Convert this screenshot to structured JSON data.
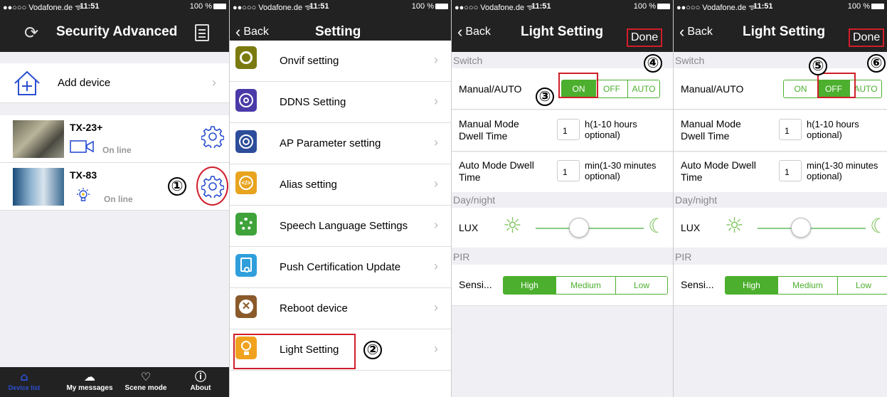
{
  "status": {
    "carrier": "●●○○○ Vodafone.de ᯤ",
    "time": "11:51",
    "battery": "100 %"
  },
  "screen1": {
    "title": "Security Advanced",
    "add_device": "Add device",
    "devices": [
      {
        "name": "TX-23+",
        "status": "On line",
        "type_icon": "camera-icon"
      },
      {
        "name": "TX-83",
        "status": "On line",
        "type_icon": "lightbulb-icon"
      }
    ],
    "tabs": [
      "Device list",
      "My messages",
      "Scene mode",
      "About"
    ],
    "marker": "①"
  },
  "screen2": {
    "back": "Back",
    "title": "Setting",
    "items": [
      {
        "label": "Onvif setting",
        "color": "#7a7a10"
      },
      {
        "label": "DDNS Setting",
        "color": "#4a3aa8"
      },
      {
        "label": "AP Parameter setting",
        "color": "#2d4d9a"
      },
      {
        "label": "Alias setting",
        "color": "#e8a41e"
      },
      {
        "label": "Speech Language Settings",
        "color": "#3fa33a"
      },
      {
        "label": "Push Certification Update",
        "color": "#2f9fdc"
      },
      {
        "label": "Reboot device",
        "color": "#8a5a2a"
      },
      {
        "label": "Light Setting",
        "color": "#f0a21e"
      }
    ],
    "marker": "②"
  },
  "light_screens": [
    {
      "back": "Back",
      "title": "Light Setting",
      "done": "Done",
      "switch_header": "Switch",
      "manual_auto": "Manual/AUTO",
      "seg": [
        "ON",
        "OFF",
        "AUTO"
      ],
      "selected": 0,
      "manual_dwell": "Manual Mode Dwell Time",
      "manual_value": "1",
      "manual_unit": "h(1-10 hours optional)",
      "auto_dwell": "Auto Mode Dwell Time",
      "auto_value": "1",
      "auto_unit": "min(1-30 minutes optional)",
      "daynight_header": "Day/night",
      "lux": "LUX",
      "lux_level": 0.4,
      "pir_header": "PIR",
      "sensi": "Sensi...",
      "sens_opts": [
        "High",
        "Medium",
        "Low"
      ],
      "sens_selected": 0,
      "markers": [
        "③",
        "④"
      ]
    },
    {
      "back": "Back",
      "title": "Light Setting",
      "done": "Done",
      "switch_header": "Switch",
      "manual_auto": "Manual/AUTO",
      "seg": [
        "ON",
        "OFF",
        "AUTO"
      ],
      "selected": 1,
      "manual_dwell": "Manual Mode Dwell Time",
      "manual_value": "1",
      "manual_unit": "h(1-10 hours optional)",
      "auto_dwell": "Auto Mode Dwell Time",
      "auto_value": "1",
      "auto_unit": "min(1-30 minutes optional)",
      "daynight_header": "Day/night",
      "lux": "LUX",
      "lux_level": 0.4,
      "pir_header": "PIR",
      "sensi": "Sensi...",
      "sens_opts": [
        "High",
        "Medium",
        "Low"
      ],
      "sens_selected": 0,
      "markers": [
        "⑤",
        "⑥"
      ]
    }
  ],
  "colors": {
    "accent_green": "#4caf2e",
    "bar_dark": "#222222",
    "highlight_red": "#d01e2a",
    "gear_blue": "#2a4fd0"
  }
}
